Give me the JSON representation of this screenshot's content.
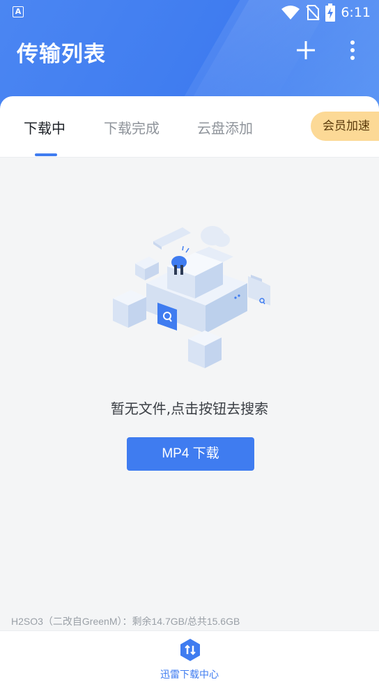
{
  "status_bar": {
    "app_indicator": "A",
    "time": "6:11",
    "icons": [
      "wifi-icon",
      "no-sim-icon",
      "battery-charging-icon"
    ]
  },
  "header": {
    "title": "传输列表",
    "add_icon": "plus-icon",
    "more_icon": "more-vertical-icon"
  },
  "tabs": [
    {
      "label": "下载中",
      "active": true
    },
    {
      "label": "下载完成",
      "active": false
    },
    {
      "label": "云盘添加",
      "active": false
    }
  ],
  "vip_button": {
    "label": "会员加速"
  },
  "empty_state": {
    "message": "暂无文件,点击按钮去搜索",
    "button_label": "MP4 下载"
  },
  "storage_info": "H2SO3（二改自GreenM）：剩余14.7GB/总共15.6GB",
  "bottom_nav": {
    "label": "迅雷下载中心",
    "icon": "download-center-icon"
  },
  "colors": {
    "accent": "#3f7cf0",
    "vip": "#fcd996",
    "background": "#f4f5f6"
  }
}
